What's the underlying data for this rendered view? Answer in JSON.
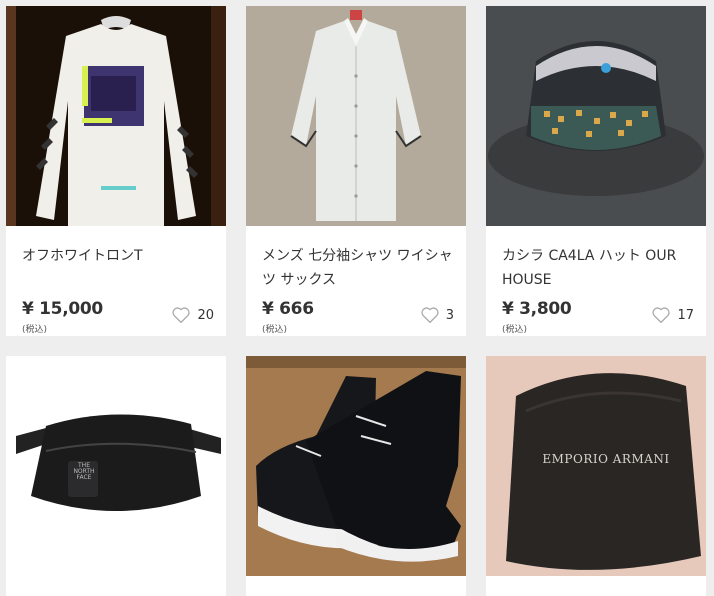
{
  "items": [
    {
      "title": "オフホワイトロンT",
      "price": "¥ 15,000",
      "tax": "(税込)",
      "likes": "20",
      "image_icon": "long-sleeve-tshirt"
    },
    {
      "title": "メンズ 七分袖シャツ ワイシャツ サックス",
      "price": "¥ 666",
      "tax": "(税込)",
      "likes": "3",
      "image_icon": "dress-shirt"
    },
    {
      "title": "カシラ CA4LA ハット OUR HOUSE",
      "price": "¥ 3,800",
      "tax": "(税込)",
      "likes": "17",
      "image_icon": "bucket-hat"
    },
    {
      "title": "",
      "image_icon": "waist-bag",
      "logo_text": "THE NORTH FACE"
    },
    {
      "title": "",
      "image_icon": "sneakers"
    },
    {
      "title": "",
      "image_icon": "armani-case",
      "logo_text": "EMPORIO ARMANI"
    }
  ]
}
